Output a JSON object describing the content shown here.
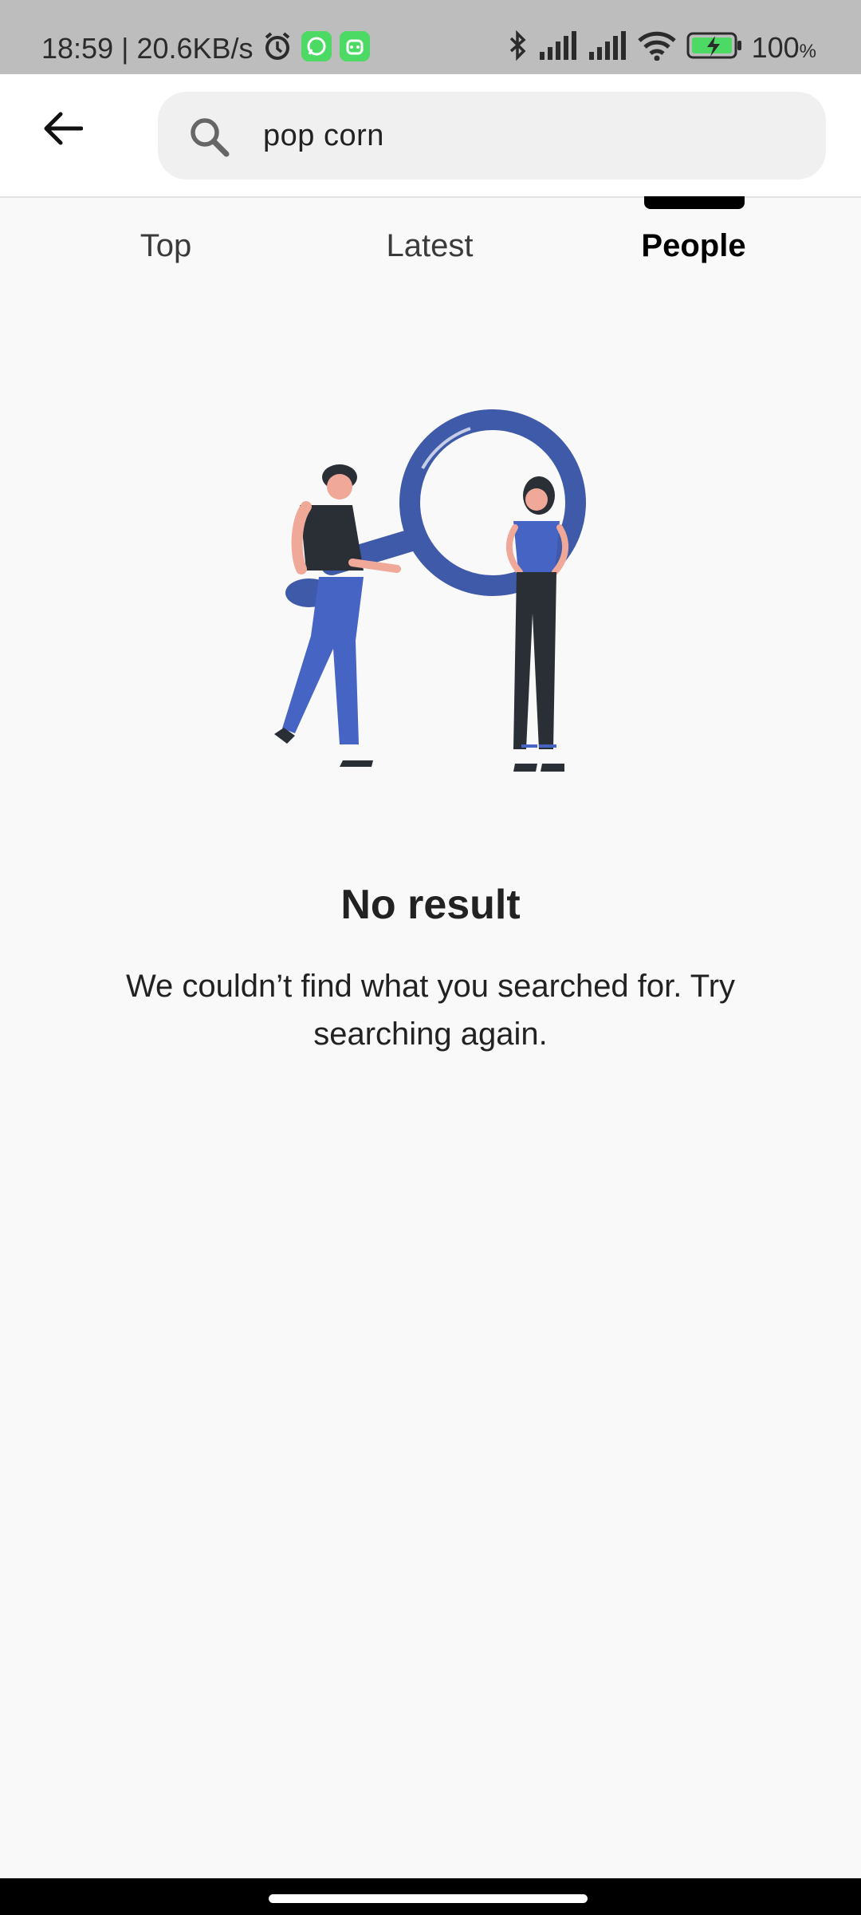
{
  "status_bar": {
    "time_speed": "18:59 | 20.6KB/s",
    "battery": "100",
    "battery_unit": "%",
    "icons": [
      "alarm-icon",
      "whatsapp-icon",
      "app-notification-icon",
      "bluetooth-icon",
      "signal-icon",
      "signal-icon",
      "wifi-icon",
      "battery-charging-icon"
    ],
    "colors": {
      "background": "#bdbdbd",
      "whatsapp": "#4cd964",
      "battery": "#4cd964"
    }
  },
  "header": {
    "back_icon": "arrow-left-icon",
    "search": {
      "icon": "search-icon",
      "query": "pop corn"
    }
  },
  "tabs": [
    {
      "label": "Top",
      "active": false
    },
    {
      "label": "Latest",
      "active": false
    },
    {
      "label": "People",
      "active": true
    }
  ],
  "empty_state": {
    "illustration": "people-with-magnifying-glass-illustration",
    "title": "No result",
    "message": "We couldn’t find what you searched for. Try searching again.",
    "accent_color": "#3f5aa8"
  }
}
